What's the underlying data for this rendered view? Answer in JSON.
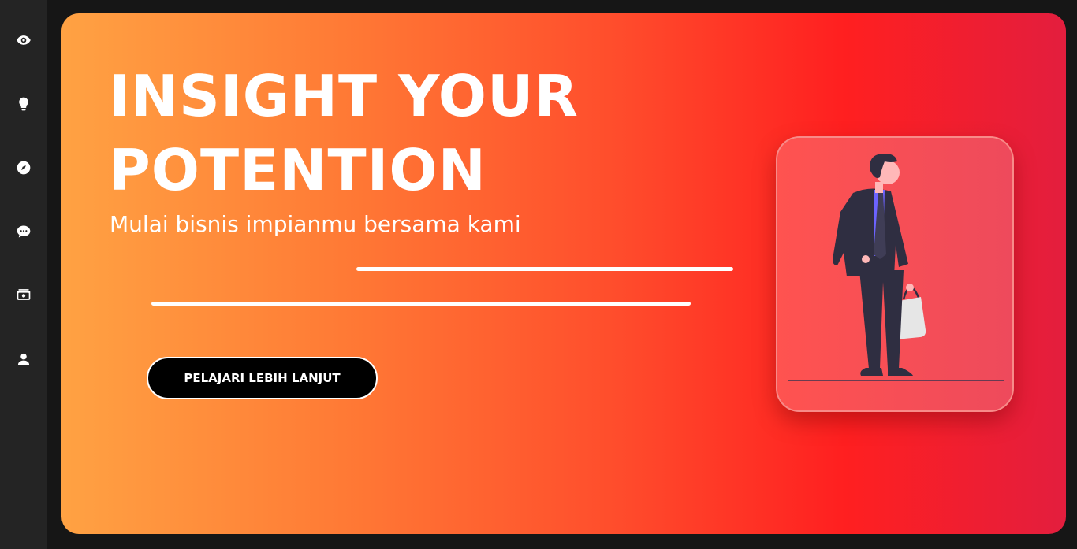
{
  "sidebar": {
    "items": [
      {
        "icon": "eye-icon"
      },
      {
        "icon": "lightbulb-icon"
      },
      {
        "icon": "compass-icon"
      },
      {
        "icon": "chat-icon"
      },
      {
        "icon": "money-icon"
      },
      {
        "icon": "user-icon"
      }
    ]
  },
  "hero": {
    "headline_line1": "INSIGHT YOUR",
    "headline_line2": "POTENTION",
    "subtitle": "Mulai bisnis impianmu bersama kami",
    "cta_label": "PELAJARI LEBIH LANJUT"
  },
  "colors": {
    "page_background": "#161616",
    "sidebar_background": "#242424",
    "gradient_start": "#ffa243",
    "gradient_mid": "#ff1f20",
    "gradient_end": "#e31e3e",
    "cta_background": "#000000",
    "card_background": "#f54e4b",
    "accent_purple": "#6c63ff"
  }
}
